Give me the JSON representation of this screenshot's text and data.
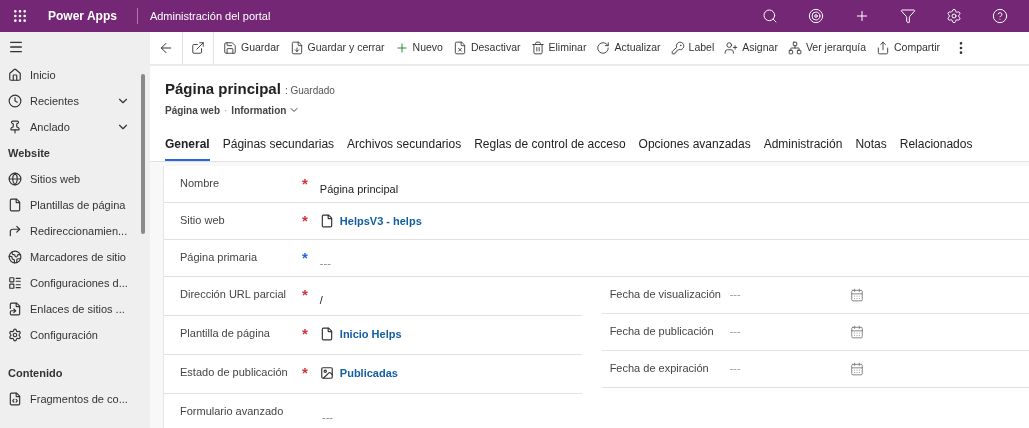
{
  "top_bar": {
    "app_name": "Power Apps",
    "area": "Administración del portal"
  },
  "sidebar": {
    "nav": [
      {
        "label": "Inicio"
      },
      {
        "label": "Recientes",
        "expanded": false
      },
      {
        "label": "Anclado",
        "expanded": false
      }
    ],
    "groups": [
      {
        "title": "Website",
        "items": [
          "Sitios web",
          "Plantillas de página",
          "Redireccionamien...",
          "Marcadores de sitio",
          "Configuraciones d...",
          "Enlaces de sitios ...",
          "Configuración"
        ]
      },
      {
        "title": "Contenido",
        "items": [
          "Fragmentos de co..."
        ]
      }
    ]
  },
  "command_bar": [
    "Guardar",
    "Guardar y cerrar",
    "Nuevo",
    "Desactivar",
    "Eliminar",
    "Actualizar",
    "Label",
    "Asignar",
    "Ver jerarquía",
    "Compartir"
  ],
  "header": {
    "title": "Página principal",
    "status": ": Guardado",
    "entity": "Página web",
    "separator": "·",
    "form": "Information"
  },
  "tabs": [
    {
      "label": "General",
      "selected": true
    },
    {
      "label": "Páginas secundarias",
      "selected": false
    },
    {
      "label": "Archivos secundarios",
      "selected": false
    },
    {
      "label": "Reglas de control de acceso",
      "selected": false
    },
    {
      "label": "Opciones avanzadas",
      "selected": false
    },
    {
      "label": "Administración",
      "selected": false
    },
    {
      "label": "Notas",
      "selected": false
    },
    {
      "label": "Relacionados",
      "selected": false
    }
  ],
  "form": {
    "full_width_fields": [
      {
        "label": "Nombre",
        "marker": "*",
        "color": "#d13438",
        "kind": "text",
        "value": "Página principal"
      },
      {
        "label": "Sitio web",
        "marker": "*",
        "color": "#d13438",
        "kind": "lookup",
        "value": "HelpsV3 - helps"
      },
      {
        "label": "Página primaria",
        "marker": "*",
        "color": "#2266e3",
        "kind": "empty",
        "value": "---"
      }
    ],
    "left_fields": [
      {
        "label": "Dirección URL parcial",
        "marker": "*",
        "color": "#d13438",
        "kind": "text",
        "value": "/"
      },
      {
        "label": "Plantilla de página",
        "marker": "*",
        "color": "#d13438",
        "kind": "lookup",
        "value": "Inicio Helps"
      },
      {
        "label": "Estado de publicación",
        "marker": "*",
        "color": "#d13438",
        "kind": "lookup",
        "value": "Publicadas"
      },
      {
        "label": "Formulario avanzado",
        "kind": "empty",
        "value": "---"
      }
    ],
    "right_fields": [
      {
        "label": "Fecha de visualización",
        "value": "---"
      },
      {
        "label": "Fecha de publicación",
        "value": "---"
      },
      {
        "label": "Fecha de expiración",
        "value": "---"
      }
    ]
  }
}
